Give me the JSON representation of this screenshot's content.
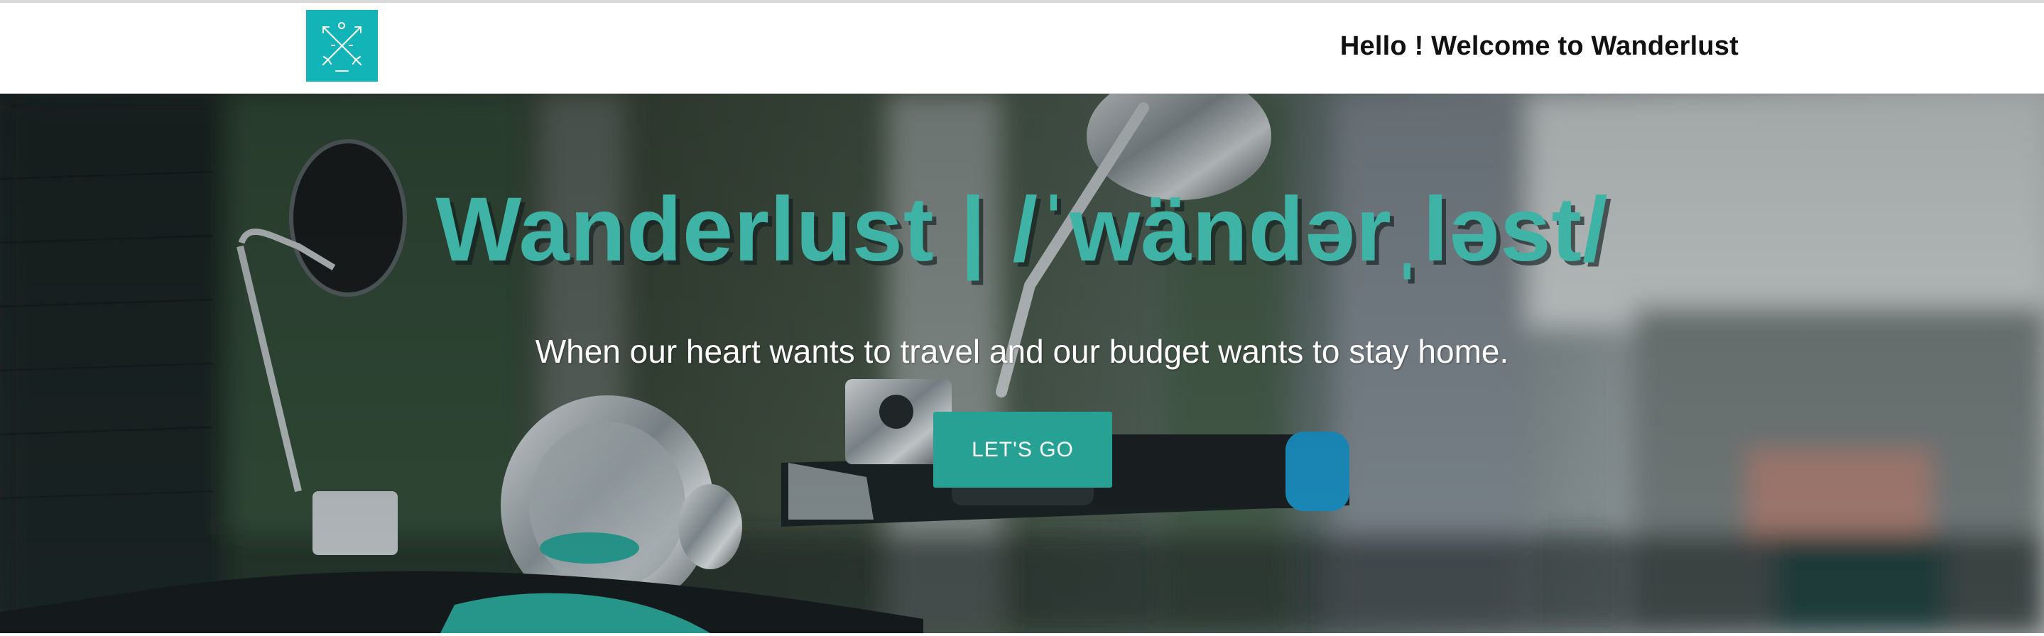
{
  "header": {
    "greeting": "Hello ! Welcome to Wanderlust",
    "logo_icon": "crossed-arrows-logo-icon"
  },
  "hero": {
    "title": "Wanderlust | /ˈwändərˌləst/",
    "subtitle": "When our heart wants to travel and our budget wants to stay home.",
    "cta_label": "LET'S GO",
    "background_image": "motorcycle-handlebar-mirror-photo"
  },
  "colors": {
    "logo_bg": "#12b4b8",
    "title": "#3fb3a5",
    "cta_bg": "#27a194",
    "cta_text": "#ffffff",
    "greeting": "#111111"
  }
}
